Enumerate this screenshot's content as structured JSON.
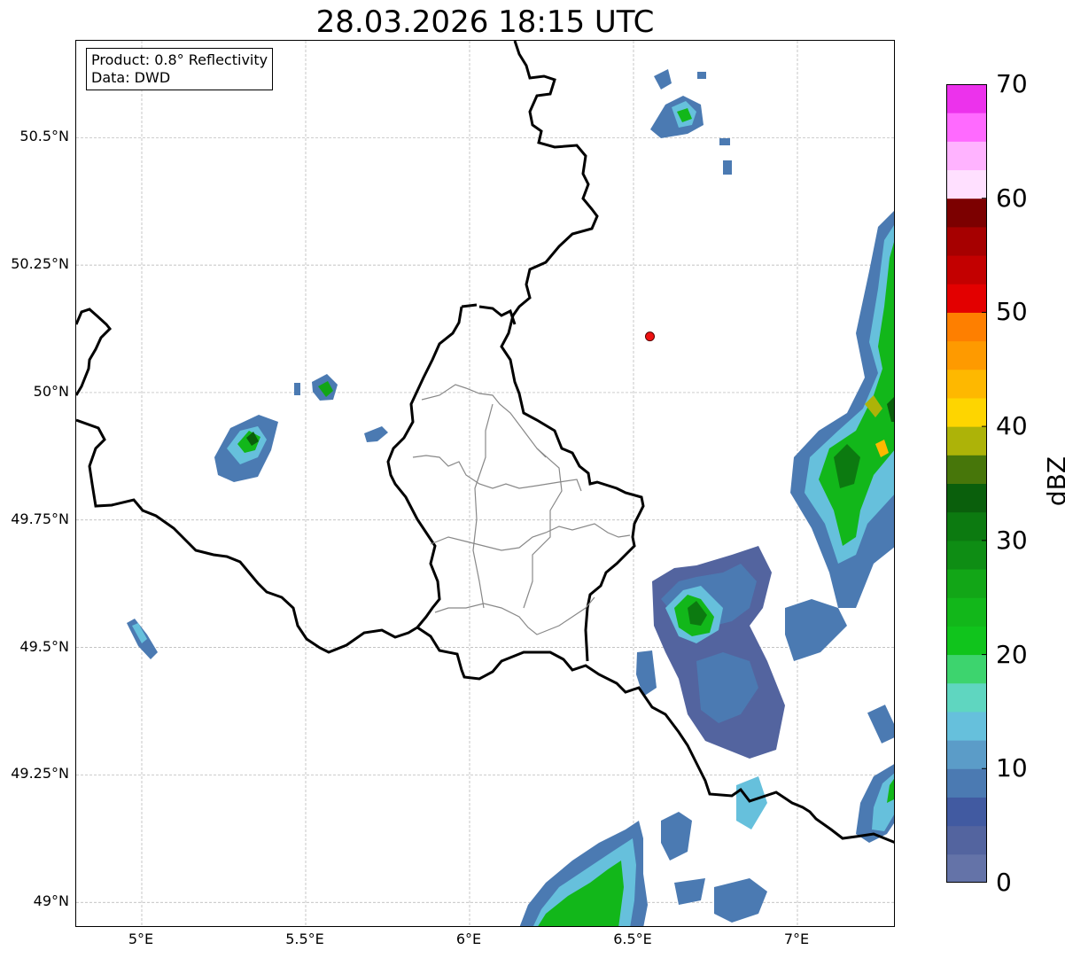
{
  "title": "28.03.2026 18:15 UTC",
  "info": {
    "product": "Product: 0.8° Reflectivity",
    "source": "Data: DWD"
  },
  "map": {
    "lon_range": [
      4.8,
      7.3
    ],
    "lat_range": [
      48.95,
      50.69
    ],
    "x_ticks": [
      {
        "value": 5.0,
        "label": "5°E"
      },
      {
        "value": 5.5,
        "label": "5.5°E"
      },
      {
        "value": 6.0,
        "label": "6°E"
      },
      {
        "value": 6.5,
        "label": "6.5°E"
      },
      {
        "value": 7.0,
        "label": "7°E"
      }
    ],
    "y_ticks": [
      {
        "value": 50.5,
        "label": "50.5°N"
      },
      {
        "value": 50.25,
        "label": "50.25°N"
      },
      {
        "value": 50.0,
        "label": "50°N"
      },
      {
        "value": 49.75,
        "label": "49.75°N"
      },
      {
        "value": 49.5,
        "label": "49.5°N"
      },
      {
        "value": 49.25,
        "label": "49.25°N"
      },
      {
        "value": 49.0,
        "label": "49°N"
      }
    ],
    "grid": true,
    "radar_site": {
      "lon": 6.55,
      "lat": 50.11,
      "color": "#ee1111"
    }
  },
  "colorbar": {
    "title": "dBZ",
    "min": 0,
    "max": 70,
    "labels": [
      "0",
      "10",
      "20",
      "30",
      "40",
      "50",
      "60",
      "70"
    ],
    "colors": [
      "#6473a8",
      "#53649f",
      "#415aa1",
      "#4b7ab2",
      "#5b9cc8",
      "#66c0dc",
      "#5fd6c0",
      "#3dd46e",
      "#10c41c",
      "#12b71a",
      "#12a617",
      "#0e8d14",
      "#0c7a10",
      "#0a5f0c",
      "#47760a",
      "#adb308",
      "#fed500",
      "#feb800",
      "#fe9a00",
      "#fe7f00",
      "#e30000",
      "#c30000",
      "#a60000",
      "#7c0000",
      "#ffe0ff",
      "#ffb3ff",
      "#ff6aff",
      "#ec32ec"
    ]
  }
}
